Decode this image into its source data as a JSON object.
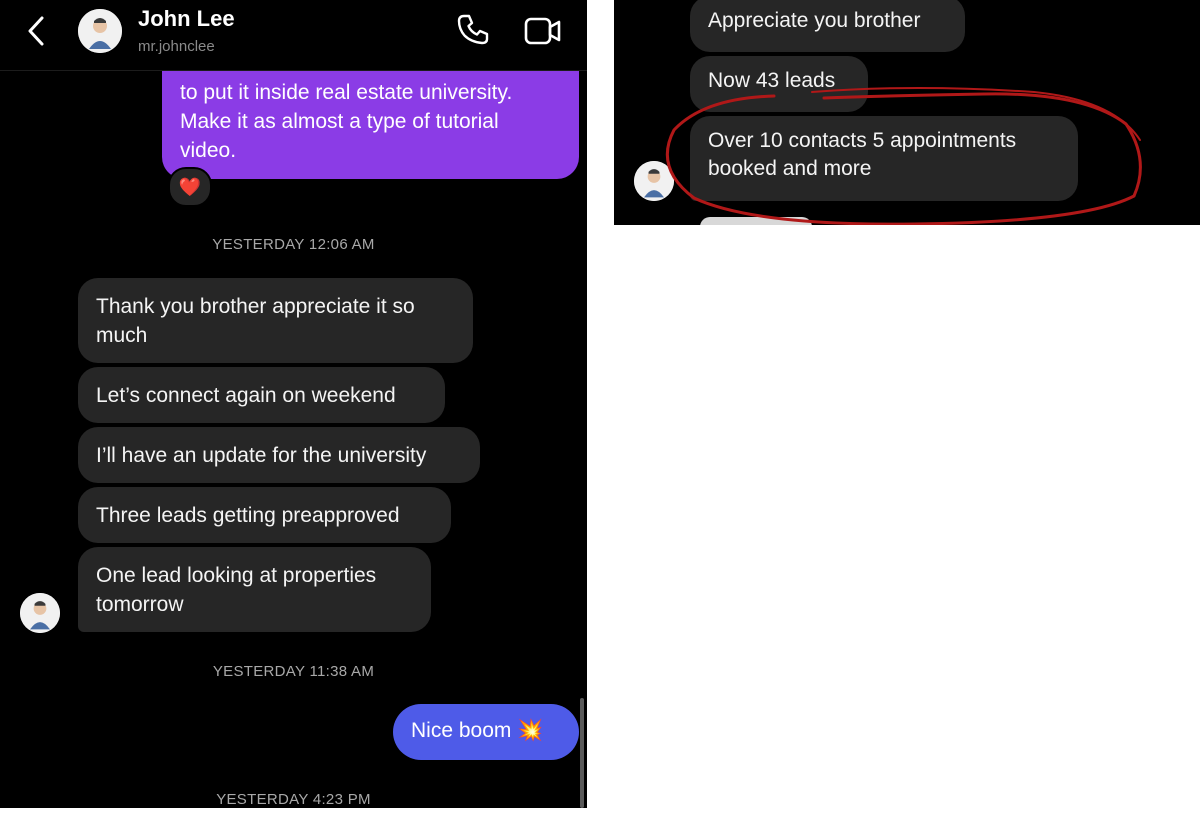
{
  "header": {
    "contact_name": "John Lee",
    "username": "mr.johnclee",
    "icons": [
      "back-chevron-icon",
      "avatar-icon",
      "phone-icon",
      "video-camera-icon"
    ]
  },
  "thread": {
    "outgoing_purple_lines": [
      "to put it inside real estate university.",
      "Make it as almost a type of tutorial",
      "video."
    ],
    "reaction": "❤️",
    "timestamp_1": "YESTERDAY 12:06 AM",
    "incoming_messages": [
      "Thank you brother appreciate it so much",
      "Let’s connect again on weekend",
      "I’ll have an update for the university",
      "Three leads getting preapproved",
      "One lead looking at properties tomorrow"
    ],
    "timestamp_2": "YESTERDAY 11:38 AM",
    "outgoing_blue": "Nice boom 💥",
    "timestamp_3": "YESTERDAY 4:23 PM"
  },
  "right_panel": {
    "messages": [
      "Appreciate you brother",
      "Now 43 leads",
      "Over 10 contacts 5 appointments booked and more"
    ],
    "annotation_color": "#b01818"
  },
  "colors": {
    "background": "#000000",
    "incoming_bubble": "#262626",
    "outgoing_purple": "#8b3ce6",
    "outgoing_blue": "#4e5be8"
  }
}
